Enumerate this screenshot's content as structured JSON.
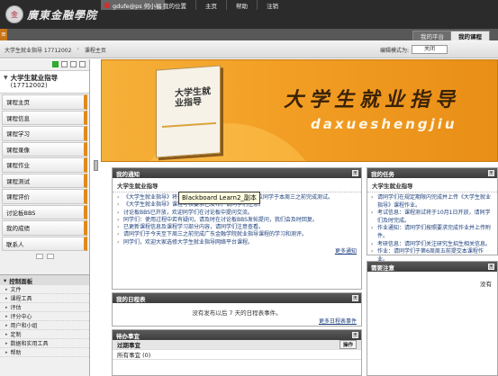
{
  "header": {
    "logo_text": "廣東金融學院",
    "logo_mark": "金",
    "user_tab": "gdufe@ps 何小福",
    "nav": [
      "我的位置",
      "主页",
      "帮助",
      "注销"
    ]
  },
  "tabs": {
    "corner": "≡",
    "inactive": "我的平台",
    "active": "我的课程"
  },
  "breadcrumb": {
    "course": "大学生就业指导 17712002",
    "sep": "›",
    "page": "课程主页"
  },
  "edit_mode": {
    "label": "编辑模式为:",
    "value": "关闭"
  },
  "sidebar": {
    "course_title": "大学生就业指导",
    "course_code": "(17712002)",
    "items": [
      "课程主页",
      "课程信息",
      "课程学习",
      "课程录像",
      "课程作业",
      "课程测试",
      "课程评价",
      "讨论板BBS",
      "我的成绩",
      "联系人"
    ],
    "panel_title": "控制面板",
    "panel_items": [
      "文件",
      "课程工具",
      "评估",
      "评分中心",
      "用户和小组",
      "定制",
      "数据和实用工具",
      "帮助"
    ]
  },
  "banner": {
    "book_title": "大学生就业指导",
    "title": "大学生就业指导",
    "pinyin": "daxueshengjiu"
  },
  "announcements": {
    "title": "我的通知",
    "subtitle": "大学生就业指导",
    "items": [
      "《大学生就业指导》将于10月1日开放\"课程测试\"，请各位同学于本周三之前完成测试。",
      "《大学生就业指导》课程考核要求已发布，请同学们注意。",
      "讨论板BBS已开放，欢迎同学们在讨论板中提问交流。",
      "同学们：使用过程中若有疑问，请及时在讨论板BBS发帖提问，我们会及时回复。",
      "已更新课程信息及课程学习部分内容，请同学们注意查看。",
      "请同学们于今天至下周三之前完成广东金融学院就业指导课程的学习和测评。",
      "同学们，欢迎大家选修大学生就业指导网络平台课程。"
    ],
    "more": "更多通知",
    "tooltip": "Blackboard Learn2_副本"
  },
  "schedule": {
    "title": "我的日程表",
    "text": "没有发布以后 7 天的日程表事件。",
    "more": "更多日程表事件"
  },
  "todo": {
    "title": "待办事宜",
    "col_due": "过期事宜",
    "col_ops": "操作",
    "all_items": "所有事宜 (0)"
  },
  "tasks": {
    "title": "我的任务",
    "subtitle": "大学生就业指导",
    "items": [
      "请同学们在规定期限内完成并上传《大学生就业指导》课程作业。",
      "考试信息：课程测试将于10月1日开放，请同学们及时完成。",
      "作业通知：请同学们按照要求完成作业并上传附件。",
      "考研信息：请同学们关注研究生招生相关信息。",
      "作业：请同学们于第6周周五前提交本课程作业。"
    ]
  },
  "needs_attention": {
    "title": "需要注意",
    "empty": "没有"
  }
}
